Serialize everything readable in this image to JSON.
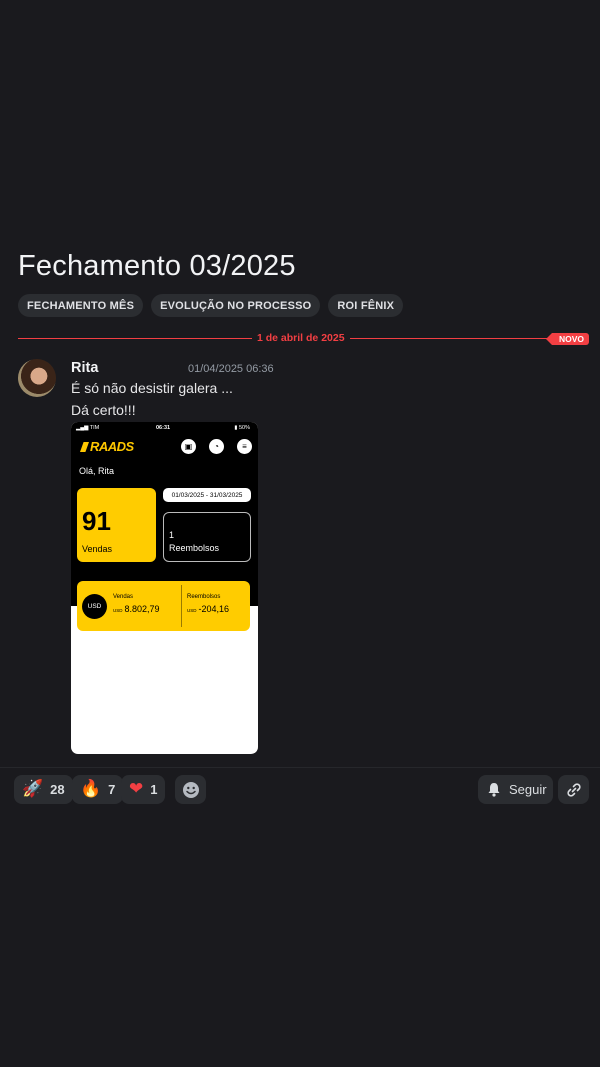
{
  "thread": {
    "title": "Fechamento 03/2025",
    "tags": [
      "FECHAMENTO MÊS",
      "EVOLUÇÃO NO PROCESSO",
      "ROI FÊNIX"
    ]
  },
  "divider": {
    "date": "1 de abril de 2025",
    "new_label": "NOVO"
  },
  "message": {
    "author": "Rita",
    "timestamp": "01/04/2025 06:36",
    "lines": [
      "É só não desistir galera ...",
      "Dá certo!!!"
    ]
  },
  "attachment": {
    "status": {
      "carrier": "TIM",
      "time": "06:31",
      "battery": "50%"
    },
    "logo": "RAADS",
    "greeting": "Olá, Rita",
    "sales": {
      "value": "91",
      "label": "Vendas"
    },
    "date_range": "01/03/2025 - 31/03/2025",
    "refunds": {
      "value": "1",
      "label": "Reembolsos"
    },
    "usd": {
      "badge": "USD",
      "sales_label": "Vendas",
      "sales_unit": "USD",
      "sales_value": "8.802,79",
      "refunds_label": "Reembolsos",
      "refunds_unit": "USD",
      "refunds_value": "-204,16"
    }
  },
  "reactions": [
    {
      "emoji": "🚀",
      "count": "28",
      "icon": "rocket-icon"
    },
    {
      "emoji": "🔥",
      "count": "7",
      "icon": "fire-icon"
    },
    {
      "emoji": "❤",
      "count": "1",
      "icon": "heart-icon"
    }
  ],
  "actions": {
    "follow_label": "Seguir"
  },
  "colors": {
    "accent_red": "#f23f43",
    "brand_yellow": "#ffcc00",
    "background": "#1a1a1e"
  }
}
